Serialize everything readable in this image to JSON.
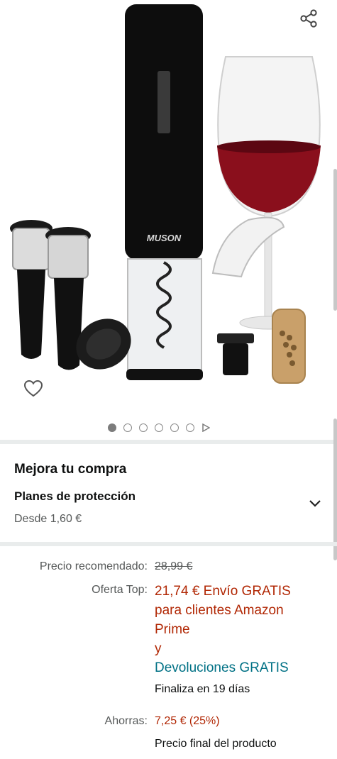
{
  "gallery": {
    "brand_text": "MUSON",
    "icons": {
      "share": "share-icon",
      "wishlist": "heart-icon",
      "video": "play-icon"
    },
    "dots_total": 6,
    "active_index": 0
  },
  "upgrade": {
    "title": "Mejora tu compra",
    "plans_title": "Planes de protección",
    "plans_from": "Desde 1,60 €"
  },
  "pricing": {
    "list_label": "Precio recomendado:",
    "list_price": "28,99 €",
    "deal_label": "Oferta Top:",
    "deal_line1": "21,74 € Envío GRATIS",
    "deal_line2": "para clientes Amazon",
    "deal_line3": "Prime",
    "deal_and": "y",
    "returns_link": "Devoluciones GRATIS",
    "deal_ends": "Finaliza en 19 días",
    "savings_label": "Ahorras:",
    "savings_value": "7,25 € (25%)",
    "final_price_note": "Precio final del producto"
  },
  "colors": {
    "deal_red": "#b12704",
    "link_teal": "#007185",
    "muted_gray": "#565959",
    "divider": "#e9ecec"
  }
}
